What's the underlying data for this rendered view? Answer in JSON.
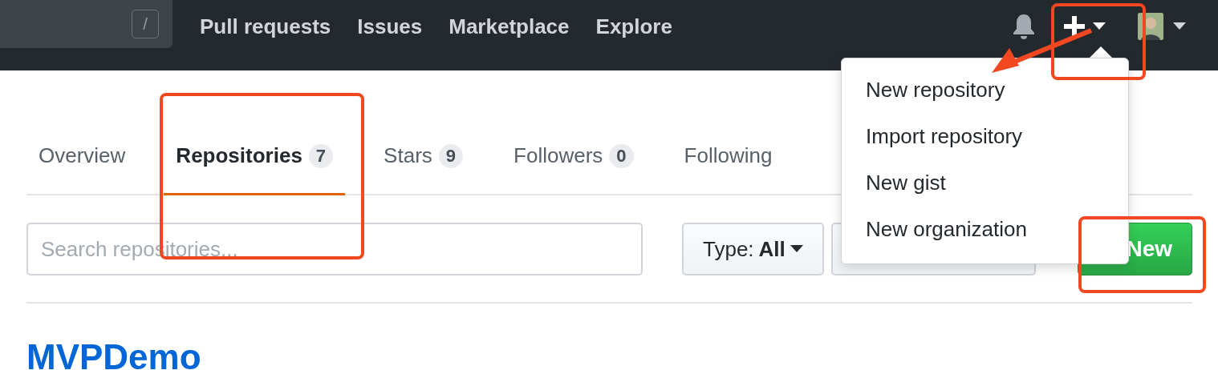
{
  "header": {
    "search_shortcut": "/",
    "nav": [
      "Pull requests",
      "Issues",
      "Marketplace",
      "Explore"
    ]
  },
  "tabs": [
    {
      "label": "Overview",
      "selected": false
    },
    {
      "label": "Repositories",
      "count": "7",
      "selected": true
    },
    {
      "label": "Stars",
      "count": "9",
      "selected": false
    },
    {
      "label": "Followers",
      "count": "0",
      "selected": false
    },
    {
      "label": "Following",
      "selected": false
    }
  ],
  "search": {
    "placeholder": "Search repositories..."
  },
  "type_filter": {
    "label": "Type:",
    "value": "All"
  },
  "new_button": {
    "label": "New"
  },
  "create_menu": {
    "open": true,
    "items": [
      "New repository",
      "Import repository",
      "New gist",
      "New organization"
    ]
  },
  "repositories": [
    {
      "name": "MVPDemo"
    }
  ]
}
